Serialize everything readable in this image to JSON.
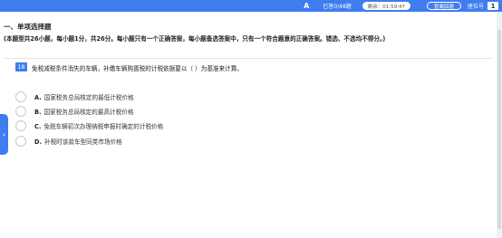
{
  "header": {
    "font_icon": "A",
    "progress": "已答0/48题",
    "timer": "剩余：01:59:47",
    "exit_label": "暂离回避",
    "seat_label": "座位号",
    "seat_number": "1"
  },
  "section": {
    "title": "一、单项选择题",
    "instructions": "(本题型共26小题，每小题1分，共26分。每小题只有一个正确答案，每小题备选答案中，只有一个符合题意的正确答案。错选、不选均不得分。)"
  },
  "question": {
    "number": "18",
    "text": "免税减税条件消失的车辆，补缴车辆购置税的计税依据要以（    ）为基准来计算。",
    "options": [
      {
        "letter": "A.",
        "text": "国家税务总局核定的最低计税价格"
      },
      {
        "letter": "B.",
        "text": "国家税务总局核定的最高计税价格"
      },
      {
        "letter": "C.",
        "text": "免税车辆初次办理纳税申报时确定的计税价格"
      },
      {
        "letter": "D.",
        "text": "补税时该款车型同类市场价格"
      }
    ]
  },
  "side_tab": {
    "glyph": "‹"
  },
  "colors": {
    "accent": "#3f7cf0"
  }
}
